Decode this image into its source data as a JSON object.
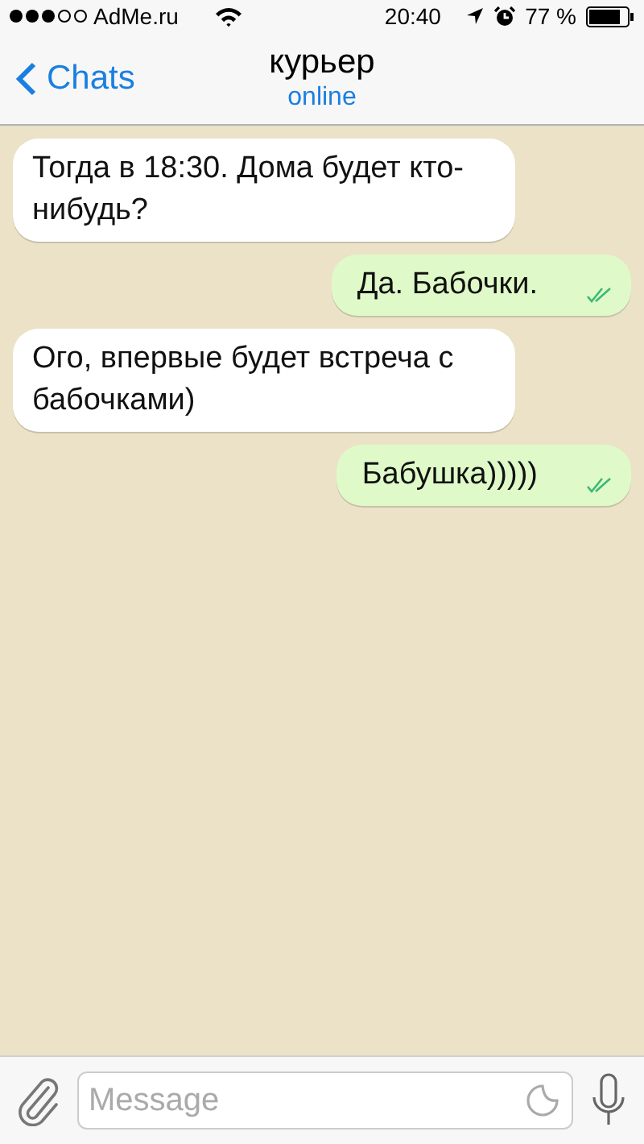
{
  "status_bar": {
    "carrier": "AdMe.ru",
    "time": "20:40",
    "battery": "77 %"
  },
  "nav": {
    "back": "Chats",
    "title": "курьер",
    "subtitle": "online"
  },
  "messages": [
    {
      "kind": "incoming",
      "text": "Тогда в 18:30. Дома будет кто-нибудь?"
    },
    {
      "kind": "outgoing",
      "text": "Да. Бабочки.",
      "read": true
    },
    {
      "kind": "incoming",
      "text": "Ого, впервые будет встреча с бабочками)"
    },
    {
      "kind": "outgoing",
      "text": "Бабушка)))))",
      "read": true
    }
  ],
  "composer": {
    "placeholder": "Message"
  }
}
